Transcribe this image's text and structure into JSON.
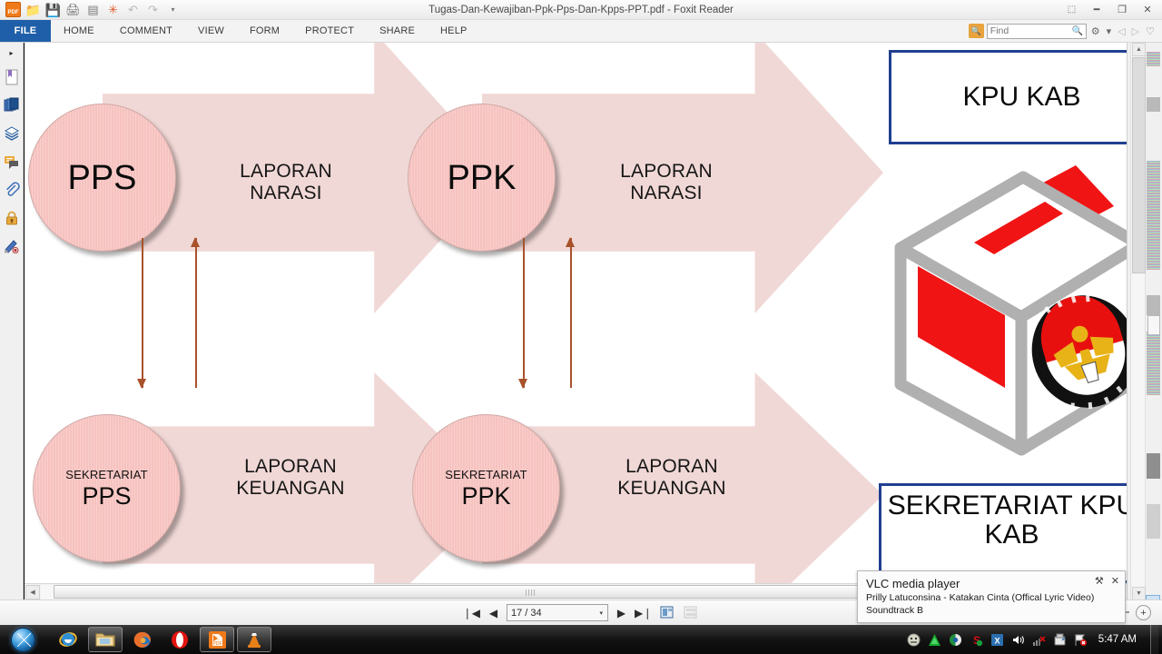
{
  "window": {
    "title": "Tugas-Dan-Kewajiban-Ppk-Pps-Dan-Kpps-PPT.pdf - Foxit Reader",
    "quick_access": [
      {
        "name": "foxit-logo-icon",
        "label": "PDF"
      },
      {
        "name": "open-icon",
        "label": "📁"
      },
      {
        "name": "save-icon",
        "label": "💾"
      },
      {
        "name": "print-icon",
        "label": "🖨"
      },
      {
        "name": "properties-icon",
        "label": "▤"
      },
      {
        "name": "new-icon",
        "label": "✳"
      },
      {
        "name": "undo-icon",
        "label": "↶"
      },
      {
        "name": "redo-icon",
        "label": "↷"
      },
      {
        "name": "customize-caret-icon",
        "label": "▾"
      }
    ],
    "controls": [
      {
        "name": "restore-ribbon-button",
        "label": "⬚"
      },
      {
        "name": "minimize-button",
        "label": "━"
      },
      {
        "name": "maximize-button",
        "label": "❐"
      },
      {
        "name": "close-button",
        "label": "✕"
      }
    ]
  },
  "menubar": {
    "file_label": "FILE",
    "items": [
      "HOME",
      "COMMENT",
      "VIEW",
      "FORM",
      "PROTECT",
      "SHARE",
      "HELP"
    ]
  },
  "search": {
    "placeholder": "Find",
    "value": "",
    "button_icon": "search-folder-icon"
  },
  "menu_right_icons": [
    {
      "name": "settings-gear-icon",
      "label": "⚙"
    },
    {
      "name": "settings-caret-icon",
      "label": "▾"
    },
    {
      "name": "previous-view-icon",
      "label": "◁"
    },
    {
      "name": "next-view-icon",
      "label": "▷"
    },
    {
      "name": "favorite-icon",
      "label": "♡"
    }
  ],
  "left_panel": {
    "expand_label": "▸",
    "items": [
      {
        "name": "bookmarks-icon",
        "label": "Bookmarks"
      },
      {
        "name": "page-thumbnails-icon",
        "label": "Page Thumbnails"
      },
      {
        "name": "layers-icon",
        "label": "Layers"
      },
      {
        "name": "comments-icon",
        "label": "Comments"
      },
      {
        "name": "attachments-icon",
        "label": "Attachments"
      },
      {
        "name": "security-lock-icon",
        "label": "Security"
      },
      {
        "name": "digital-signature-icon",
        "label": "Digital Signatures"
      }
    ]
  },
  "slide": {
    "nodes": [
      {
        "id": "pps",
        "main": "PPS",
        "sub": ""
      },
      {
        "id": "ppk",
        "main": "PPK",
        "sub": ""
      },
      {
        "id": "sek-pps",
        "main": "PPS",
        "sub": "SEKRETARIAT"
      },
      {
        "id": "sek-ppk",
        "main": "PPK",
        "sub": "SEKRETARIAT"
      }
    ],
    "arrows": [
      {
        "id": "arrow-pps-narasi",
        "line1": "LAPORAN",
        "line2": "NARASI"
      },
      {
        "id": "arrow-ppk-narasi",
        "line1": "LAPORAN",
        "line2": "NARASI"
      },
      {
        "id": "arrow-pps-keuangan",
        "line1": "LAPORAN",
        "line2": "KEUANGAN"
      },
      {
        "id": "arrow-ppk-keuangan",
        "line1": "LAPORAN",
        "line2": "KEUANGAN"
      }
    ],
    "boxes": [
      {
        "id": "kpu-kab",
        "text": "KPU KAB"
      },
      {
        "id": "sekretariat-kpu-kab",
        "text": "SEKRETARIAT KPU KAB"
      }
    ],
    "colors": {
      "arrow_fill": "#f0d8d6",
      "circle_fill": "#f6c2bf",
      "connector": "#a8512b",
      "box_border": "#1f3f8f",
      "ballot_red": "#f01414",
      "ballot_grey": "#b0b0b0"
    },
    "ballot_box_label": "KPU ballot box with Komisi Pemilihan Umum emblem"
  },
  "statusbar": {
    "first_page_label": "❘◀",
    "prev_page_label": "◀",
    "page_value": "17 / 34",
    "page_caret": "▾",
    "next_page_label": "▶",
    "last_page_label": "▶❘",
    "fit_page_label": "⌸",
    "fit_width_label": "⌷",
    "zoom_out_label": "−",
    "zoom_in_label": "+"
  },
  "hscroll": {
    "left_arrow": "◀",
    "right_arrow": "▶"
  },
  "right_panel": {
    "up_arrow": "▲",
    "down_arrow": "▼",
    "bottom_left_icon": "▸",
    "bottom_right_icon": "↓"
  },
  "vlc": {
    "title": "VLC media player",
    "line1": "Prilly Latuconsina - Katakan Cinta (Offical Lyric Video)",
    "line2": "Soundtrack B",
    "pin_label": "⚒",
    "close_label": "✕"
  },
  "taskbar": {
    "start_label": "Start",
    "items": [
      {
        "name": "taskbar-internet-explorer",
        "label": "e",
        "active": false
      },
      {
        "name": "taskbar-file-explorer",
        "label": "🗁",
        "active": true
      },
      {
        "name": "taskbar-firefox",
        "label": "◉",
        "active": false
      },
      {
        "name": "taskbar-opera",
        "label": "O",
        "active": false
      },
      {
        "name": "taskbar-foxit-reader",
        "label": "PDF",
        "active": true
      },
      {
        "name": "taskbar-vlc",
        "label": "▲",
        "active": true
      }
    ],
    "tray": [
      {
        "name": "tray-app-icon",
        "label": "●"
      },
      {
        "name": "tray-updater-icon",
        "label": "▲"
      },
      {
        "name": "tray-graphics-icon",
        "label": "◑"
      },
      {
        "name": "tray-antivirus-icon",
        "label": "S"
      },
      {
        "name": "tray-office-icon",
        "label": "X"
      },
      {
        "name": "tray-volume-icon",
        "label": "🔊"
      },
      {
        "name": "tray-network-icon",
        "label": "█"
      },
      {
        "name": "tray-removable-icon",
        "label": "⏏"
      },
      {
        "name": "tray-action-center-icon",
        "label": "⚑"
      }
    ],
    "clock": "5:47 AM"
  }
}
